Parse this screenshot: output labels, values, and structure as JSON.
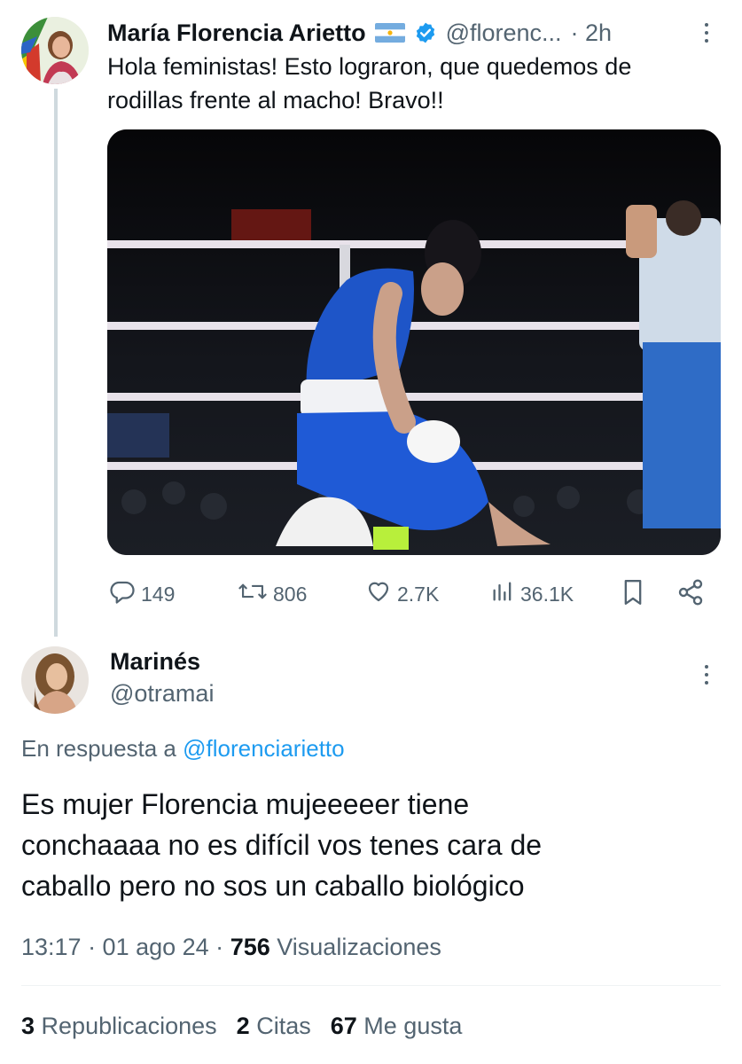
{
  "original_tweet": {
    "author_name": "María Florencia Arietto",
    "flag_icon": "argentina-flag",
    "verified_icon": "verified-badge-icon",
    "handle": "@florenc...",
    "time": "· 2h",
    "text_line1": "Hola feministas! Esto lograron, que quedemos de",
    "text_line2": "rodillas frente al macho! Bravo!!",
    "actions": {
      "replies": "149",
      "reposts": "806",
      "likes": "2.7K",
      "views": "36.1K"
    }
  },
  "reply": {
    "author_name": "Marinés",
    "handle": "@otramai",
    "in_reply_prefix": "En respuesta a",
    "in_reply_handle": "@florenciarietto",
    "text_line1": "Es mujer Florencia mujeeeeer tiene",
    "text_line2": "conchaaaa no es difícil vos tenes cara de",
    "text_line3": "caballo pero no sos un caballo biológico",
    "timestamp": "13:17 · 01 ago 24 ·",
    "view_count": "756",
    "view_label": "Visualizaciones",
    "stats": {
      "reposts_count": "3",
      "reposts_label": "Republicaciones",
      "quotes_count": "2",
      "quotes_label": "Citas",
      "likes_count": "67",
      "likes_label": "Me gusta"
    }
  },
  "colors": {
    "text_primary": "#0f1419",
    "text_secondary": "#536471",
    "link_blue": "#1d9bf0",
    "verified_blue": "#1d9bf0",
    "thread_line": "#cfd9de"
  }
}
